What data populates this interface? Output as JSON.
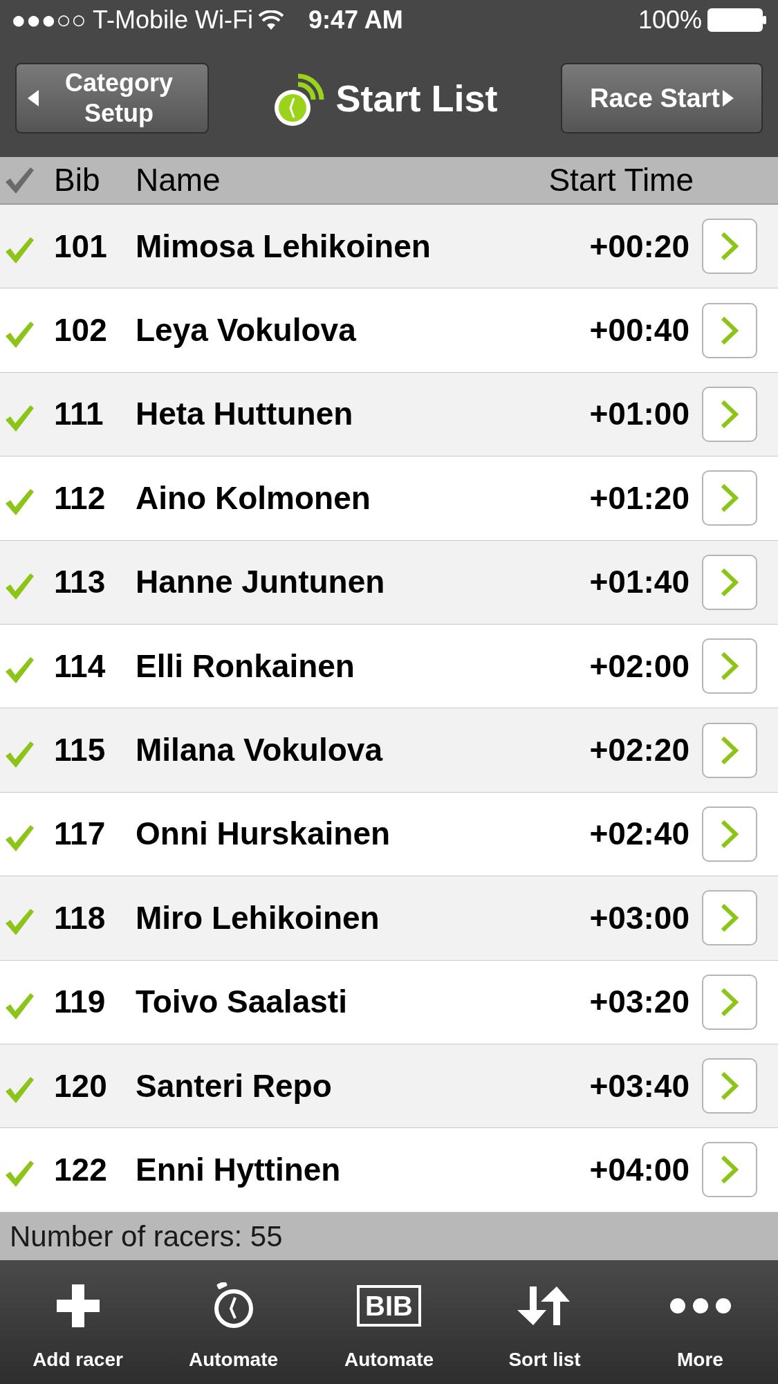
{
  "status_bar": {
    "carrier": "●●●○○ T-Mobile Wi-Fi",
    "time": "9:47 AM",
    "battery": "100%"
  },
  "nav": {
    "back": "Category Setup",
    "title": "Start List",
    "forward": "Race Start"
  },
  "table": {
    "columns": [
      "Bib",
      "Name",
      "Start Time"
    ],
    "rows": [
      {
        "bib": "101",
        "name": "Mimosa Lehikoinen",
        "start": "+00:20",
        "checked": true
      },
      {
        "bib": "102",
        "name": "Leya Vokulova",
        "start": "+00:40",
        "checked": true
      },
      {
        "bib": "111",
        "name": "Heta Huttunen",
        "start": "+01:00",
        "checked": true
      },
      {
        "bib": "112",
        "name": "Aino Kolmonen",
        "start": "+01:20",
        "checked": true
      },
      {
        "bib": "113",
        "name": "Hanne Juntunen",
        "start": "+01:40",
        "checked": true
      },
      {
        "bib": "114",
        "name": "Elli Ronkainen",
        "start": "+02:00",
        "checked": true
      },
      {
        "bib": "115",
        "name": "Milana Vokulova",
        "start": "+02:20",
        "checked": true
      },
      {
        "bib": "117",
        "name": "Onni Hurskainen",
        "start": "+02:40",
        "checked": true
      },
      {
        "bib": "118",
        "name": "Miro Lehikoinen",
        "start": "+03:00",
        "checked": true
      },
      {
        "bib": "119",
        "name": "Toivo Saalasti",
        "start": "+03:20",
        "checked": true
      },
      {
        "bib": "120",
        "name": "Santeri Repo",
        "start": "+03:40",
        "checked": true
      },
      {
        "bib": "122",
        "name": "Enni Hyttinen",
        "start": "+04:00",
        "checked": true
      }
    ]
  },
  "footer": "Number of racers: 55",
  "toolbar": [
    {
      "kind": "add",
      "label": "Add racer"
    },
    {
      "kind": "stopwatch",
      "label": "Automate"
    },
    {
      "kind": "bib",
      "label": "Automate",
      "icon_text": "BIB"
    },
    {
      "kind": "sort",
      "label": "Sort list"
    },
    {
      "kind": "more",
      "label": "More"
    }
  ]
}
